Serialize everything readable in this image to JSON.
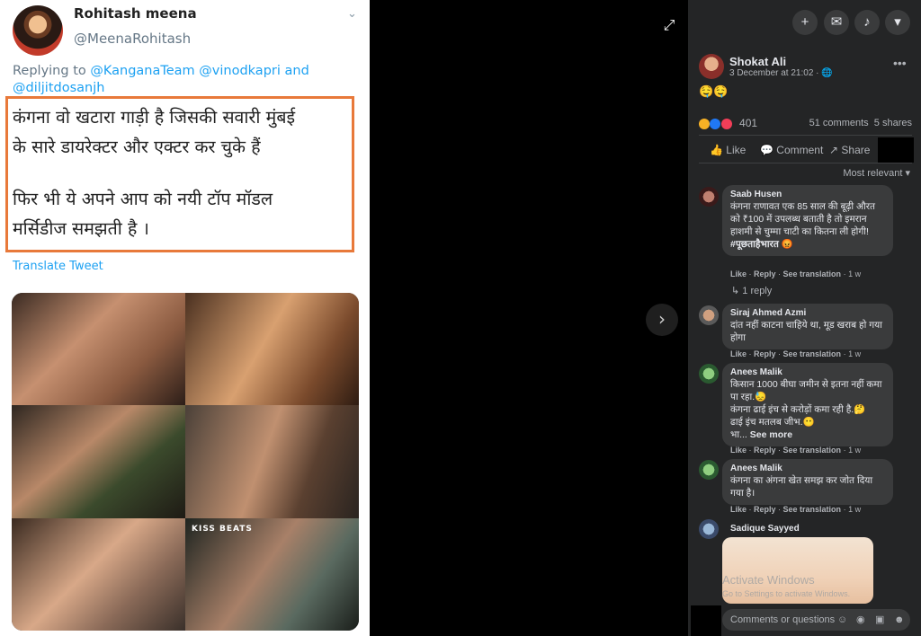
{
  "tweet": {
    "name": "Rohitash meena",
    "handle": "@MeenaRohitash",
    "replying_prefix": "Replying to ",
    "replying_to": "@KanganaTeam @vinodkapri",
    "replying_and": " and",
    "replying_to_2": "@diljitdosanjh",
    "text_line1": "कंगना वो खटारा गाड़ी है जिसकी सवारी मुंबई",
    "text_line2": "के सारे डायरेक्टर और एक्टर कर चुके हैं",
    "text_line3": "फिर भी ये अपने आप को नयी टॉप मॉडल",
    "text_line4": "मर्सिडीज समझती है ।",
    "translate": "Translate Tweet",
    "watermark": "KISS BEATS"
  },
  "viewer": {
    "expand_icon": "expand-icon",
    "next_icon": "chevron-right-icon",
    "next_glyph": "›"
  },
  "panel": {
    "top_icons": [
      "plus-icon",
      "messenger-icon",
      "bell-icon",
      "caret-down-icon"
    ],
    "post": {
      "author": "Shokat Ali",
      "time": "3 December at 21:02 · ",
      "emoji": "🤤🤤",
      "reactions_count": "401",
      "comments": "51 comments",
      "shares": "5 shares",
      "like": "Like",
      "comment": "Comment",
      "share": "Share"
    },
    "sort": "Most relevant",
    "comments": [
      {
        "name": "Saab Husen",
        "text": "कंगना राणावत एक 85 साल की बूढ़ी औरत को ₹100 में उपलब्ध बताती है तो इमरान हाशमी से चुम्मा चाटी का कितना ली होगी!",
        "hashtag": "#पूछताहैभारत",
        "like": "Like",
        "reply": "Reply",
        "see": "See translation",
        "time": "1 w",
        "replies": "1 reply"
      },
      {
        "name": "Siraj Ahmed Azmi",
        "text": "दांत नहीं काटना चाहिये था, मूड खराब हो गया होगा",
        "like": "Like",
        "reply": "Reply",
        "see": "See translation",
        "time": "1 w"
      },
      {
        "name": "Anees Malik",
        "text1": "किसान 1000 बीघा जमीन से इतना नहीं कमा पा रहा.",
        "text2": "कंगना ढाई इंच से करोड़ों कमा रही है.",
        "text3": "ढाई इंच मतलब जीभ.",
        "text4": "भा...",
        "see_more": "See more",
        "like": "Like",
        "reply": "Reply",
        "see": "See translation",
        "time": "1 w"
      },
      {
        "name": "Anees Malik",
        "text": "कंगना का अंगना खेत समझ कर जोत दिया गया है।",
        "like": "Like",
        "reply": "Reply",
        "see": "See translation",
        "time": "1 w"
      },
      {
        "name": "Sadique Sayyed"
      }
    ],
    "watermark1": "Activate Windows",
    "watermark2": "Go to Settings to activate Windows.",
    "input_placeholder": "Comments or questions"
  }
}
